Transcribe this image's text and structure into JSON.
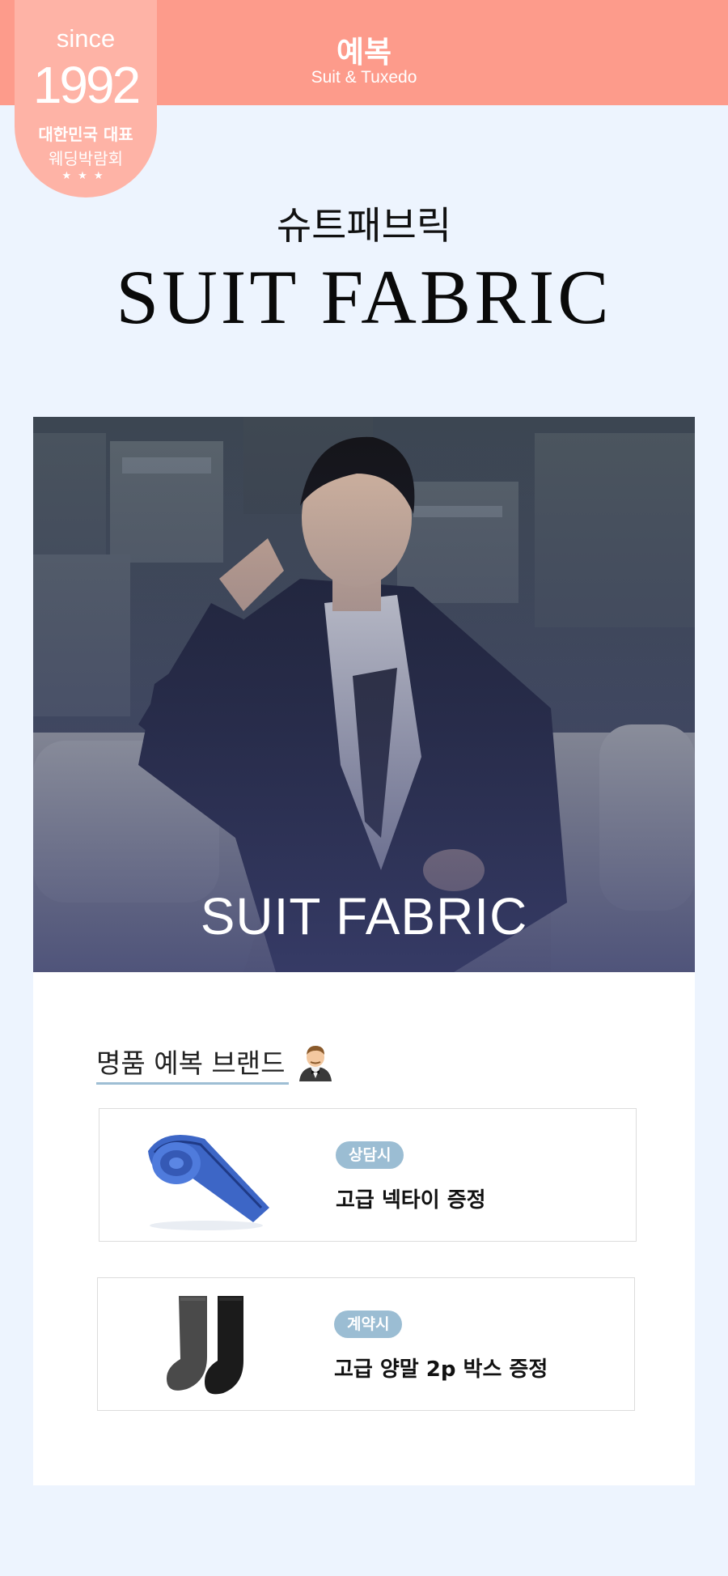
{
  "header": {
    "title": "예복",
    "subtitle": "Suit & Tuxedo"
  },
  "badge": {
    "since": "since",
    "year": "1992",
    "line1": "대한민국 대표",
    "line2": "웨딩박람회",
    "stars": "★★★"
  },
  "hero": {
    "title_kr": "슈트패브릭",
    "title_en": "SUIT FABRIC"
  },
  "photo": {
    "caption": "SUIT FABRIC"
  },
  "brand": {
    "label": "명품 예복 브랜드",
    "icon": "man-in-tuxedo-icon"
  },
  "gifts": [
    {
      "tag": "상담시",
      "text": "고급 넥타이 증정",
      "icon": "necktie-icon"
    },
    {
      "tag": "계약시",
      "text": "고급 양말 2p 박스 증정",
      "icon": "socks-icon"
    }
  ],
  "colors": {
    "header": "#fd9b8b",
    "badge": "#feb3a6",
    "background": "#edf4fe",
    "tag": "#9bbdd3"
  }
}
